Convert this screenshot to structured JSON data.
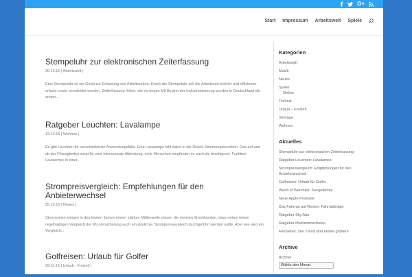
{
  "social": {
    "icons": [
      "facebook-icon",
      "twitter-icon",
      "google-plus-icon",
      "rss-icon"
    ],
    "gplus_label": "G+"
  },
  "nav": {
    "items": [
      "Start",
      "Impressum",
      "Arbeitswelt",
      "Spiele"
    ]
  },
  "posts": [
    {
      "title": "Stempeluhr zur elektronischen Zeiterfassung",
      "date": "30.12.15",
      "category": "Arbeitswelt",
      "excerpt": "Eine Stempeluhr ist ein Gerät zur Erfassung von Arbeitszeiten. Durch die Stempeluhr soll die Arbeitszeit leichter und effizienter erfasst sowie verarbeitet werden. Zeiterfassung früher, wie es began Mit Beginn der Industrialisierung wurden in Deutschland die ersten..."
    },
    {
      "title": "Ratgeber Leuchten: Lavalampe",
      "date": "13.12.15",
      "category": "Wohnen",
      "excerpt": "Es gibt Leuchten für verschiedenste Anwendungsfälle. Eine Lavalampe fällt dabei in die Rubrik Stimmungsleuchten. Das auf und ab der Flüssigkeiten sorgt für eine interessante Ablenkung, viele Menschen empfinden es auch als beruhigend. Funktion Lavalampe In einer..."
    },
    {
      "title": "Strompreisvergleich: Empfehlungen für den Anbieterwechsel",
      "date": "05.12.15",
      "category": "Neues",
      "excerpt": "Strompreise steigen in den letzten Jahren immer stärker. Mittlerweile wissen die meisten Stromkunden, dass neben einem regelmäßigen Vergleich der Kfz-Versicherung auch ein jährlicher Strompreisvergleich durchgeführt werden sollte. Aber wie wird ein Vergleich..."
    },
    {
      "title": "Golfreisen: Urlaub für Golfer",
      "date": "29.11.15",
      "category": "Urlaub - Freizeit",
      "excerpt": ""
    }
  ],
  "sidebar": {
    "categories_title": "Kategorien",
    "categories": [
      {
        "label": "Arbeitswelt",
        "sub": false
      },
      {
        "label": "Musik",
        "sub": false
      },
      {
        "label": "Neues",
        "sub": false
      },
      {
        "label": "Spiele",
        "sub": false
      },
      {
        "label": "Online",
        "sub": true
      },
      {
        "label": "Technik",
        "sub": false
      },
      {
        "label": "Urlaub – Freizeit",
        "sub": false
      },
      {
        "label": "Verträge",
        "sub": false
      },
      {
        "label": "Wohnen",
        "sub": false
      }
    ],
    "recent_title": "Aktuelles",
    "recent": [
      "Stempeluhr zur elektronischen Zeiterfassung",
      "Ratgeber Leuchten: Lavalampe",
      "Strompreisvergleich: Empfehlungen für den Anbieterwechsel",
      "Golfreisen: Urlaub für Golfer",
      "World of Warships: Seegefechte",
      "Neue Apple Produkte",
      "Das Fahrrad auf Reisen: Fahrradträger",
      "Ratgeber Sky Abo",
      "Ratgeber Matratzenschoner",
      "Fernseher: Der Trend sind immer größere"
    ],
    "archive_title": "Archive",
    "archive_label": "Archive",
    "archive_select": "Wähle den Monat"
  },
  "colors": {
    "background": "#2e78c7",
    "top_bar": "#2ea3f2"
  }
}
